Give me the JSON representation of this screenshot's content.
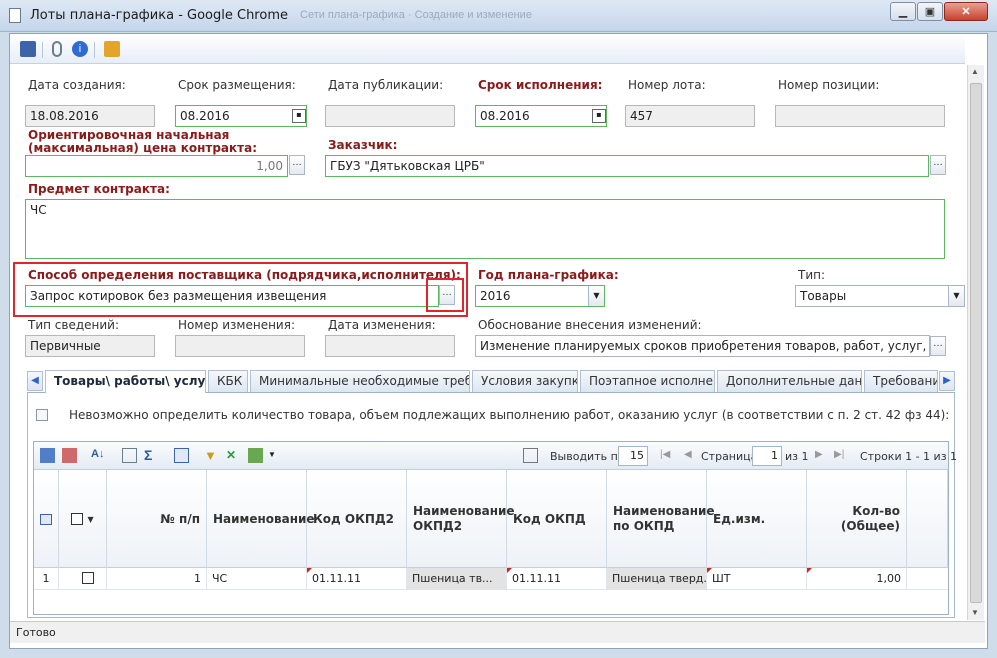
{
  "window": {
    "title": "Лоты плана-графика - Google Chrome",
    "ghost_tabs": "Сети плана-графика · Создание и изменение"
  },
  "form": {
    "date_created": {
      "label": "Дата создания:",
      "value": "18.08.2016"
    },
    "placement_term": {
      "label": "Срок размещения:",
      "value": "08.2016"
    },
    "publish_date": {
      "label": "Дата публикации:",
      "value": ""
    },
    "execution_term": {
      "label": "Срок исполнения:",
      "value": "08.2016"
    },
    "lot_number": {
      "label": "Номер лота:",
      "value": "457"
    },
    "position_number": {
      "label": "Номер позиции:",
      "value": ""
    },
    "initial_price": {
      "label_line1": "Ориентировочная начальная",
      "label_line2": "(максимальная) цена контракта:",
      "value": "1,00"
    },
    "customer": {
      "label": "Заказчик:",
      "value": "ГБУЗ \"Дятьковская ЦРБ\""
    },
    "subject": {
      "label": "Предмет контракта:",
      "value": "ЧС"
    },
    "supplier_method": {
      "label": "Способ определения поставщика (подрядчика,исполнителя):",
      "value": "Запрос котировок без размещения извещения"
    },
    "plan_year": {
      "label": "Год плана-графика:",
      "value": "2016"
    },
    "type": {
      "label": "Тип:",
      "value": "Товары"
    },
    "info_type": {
      "label": "Тип сведений:",
      "value": "Первичные"
    },
    "change_number": {
      "label": "Номер изменения:",
      "value": ""
    },
    "change_date": {
      "label": "Дата изменения:",
      "value": ""
    },
    "change_reason": {
      "label": "Обоснование внесения изменений:",
      "value": "Изменение планируемых сроков приобретения товаров, работ, услуг, способа р"
    }
  },
  "tabs": [
    {
      "label": "Товары\\ работы\\ услуги"
    },
    {
      "label": "КБК"
    },
    {
      "label": "Минимальные необходимые требования"
    },
    {
      "label": "Условия закупки"
    },
    {
      "label": "Поэтапное исполнение"
    },
    {
      "label": "Дополнительные данные"
    },
    {
      "label": "Требования"
    }
  ],
  "tab_content": {
    "checkbox_label": "Невозможно определить количество товара, объем подлежащих выполнению работ, оказанию услуг (в соответствии с п. 2 ст. 42 фз 44):"
  },
  "grid": {
    "pager": {
      "show_label": "Выводить по",
      "show_value": "15",
      "page_label": "Страница",
      "page_value": "1",
      "of_label": "из 1",
      "rows_label": "Строки 1 - 1 из 1"
    },
    "columns": [
      "№ п/п",
      "Наименование",
      "Код ОКПД2",
      "Наименование ОКПД2",
      "Код ОКПД",
      "Наименование по ОКПД",
      "Ед.изм.",
      "Кол-во (Общее)"
    ],
    "rows": [
      {
        "index": "1",
        "num": "1",
        "name": "ЧС",
        "okpd2_code": "01.11.11",
        "okpd2_name": "Пшеница тв...",
        "okpd_code": "01.11.11",
        "okpd_name": "Пшеница тверд...",
        "unit": "ШТ",
        "qty": "1,00"
      }
    ]
  },
  "status": "Готово",
  "colors": {
    "required_label": "#8b1a1a",
    "highlight": "#e0262b",
    "valid_border": "#5cb85c"
  }
}
